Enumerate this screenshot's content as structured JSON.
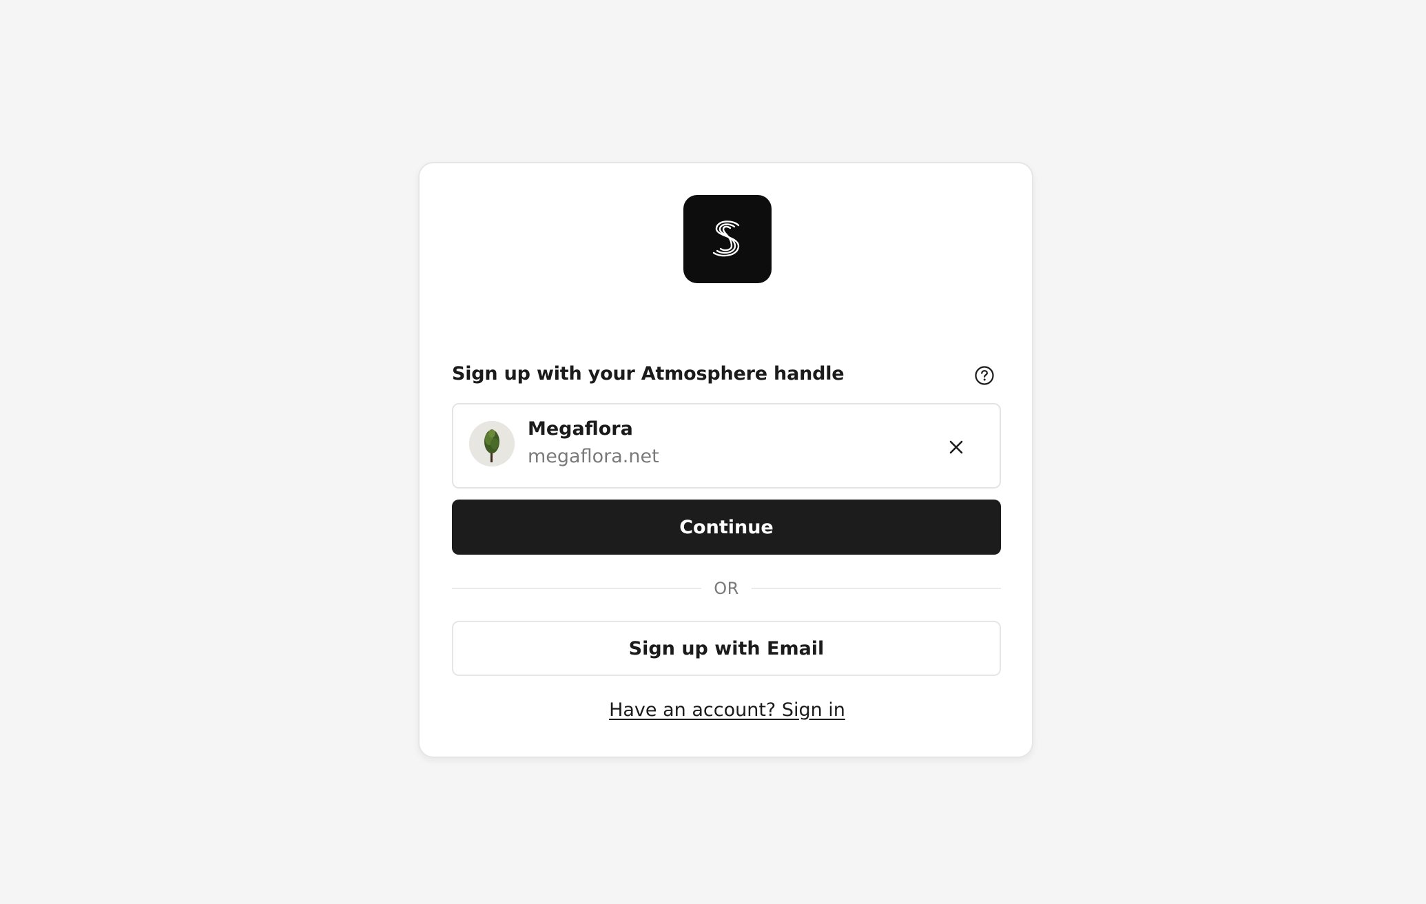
{
  "app": {
    "logo_icon": "swirl-s-logo-icon",
    "accent_color": "#1c1c1d",
    "background_color": "#f5f5f5"
  },
  "signup": {
    "handle_label": "Sign up with your Atmosphere handle",
    "help_icon": "question-circle-icon",
    "account": {
      "display_name": "Megaflora",
      "handle": "megaflora.net",
      "avatar_icon": "tree-avatar-icon",
      "remove_icon": "close-icon"
    },
    "continue_label": "Continue",
    "divider_text": "OR",
    "email_button_label": "Sign up with Email",
    "signin_link_label": "Have an account? Sign in"
  }
}
